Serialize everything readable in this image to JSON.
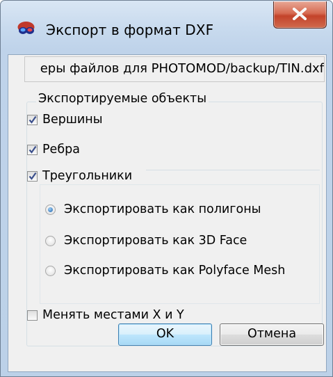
{
  "window": {
    "title": "Экспорт в формат DXF",
    "app_icon": "stereo-glasses-icon",
    "close_icon": "close-icon"
  },
  "path": {
    "value": "еры файлов для PHOTOMOD/backup/TIN.dxf"
  },
  "objects_group": {
    "legend": "Экспортируемые объекты",
    "vertices": {
      "label": "Вершины",
      "checked": true
    },
    "edges": {
      "label": "Ребра",
      "checked": true
    },
    "triangles": {
      "label": "Треугольники",
      "checked": true
    },
    "export_options": [
      {
        "label": "Экспортировать как полигоны",
        "selected": true
      },
      {
        "label": "Экспортировать как 3D Face",
        "selected": false
      },
      {
        "label": "Экспортировать как Polyface Mesh",
        "selected": false
      }
    ]
  },
  "swap_xy": {
    "label": "Менять местами X и Y",
    "checked": false
  },
  "buttons": {
    "ok": "OK",
    "cancel": "Отмена"
  },
  "colors": {
    "title_gradient_top": "#d9e6f4",
    "client_bg": "#f0f0f0",
    "close_red": "#c3432a",
    "checkmark_blue": "#3b4f8c",
    "radio_blue": "#1c5fa8",
    "ok_border": "#3c7fb1"
  }
}
